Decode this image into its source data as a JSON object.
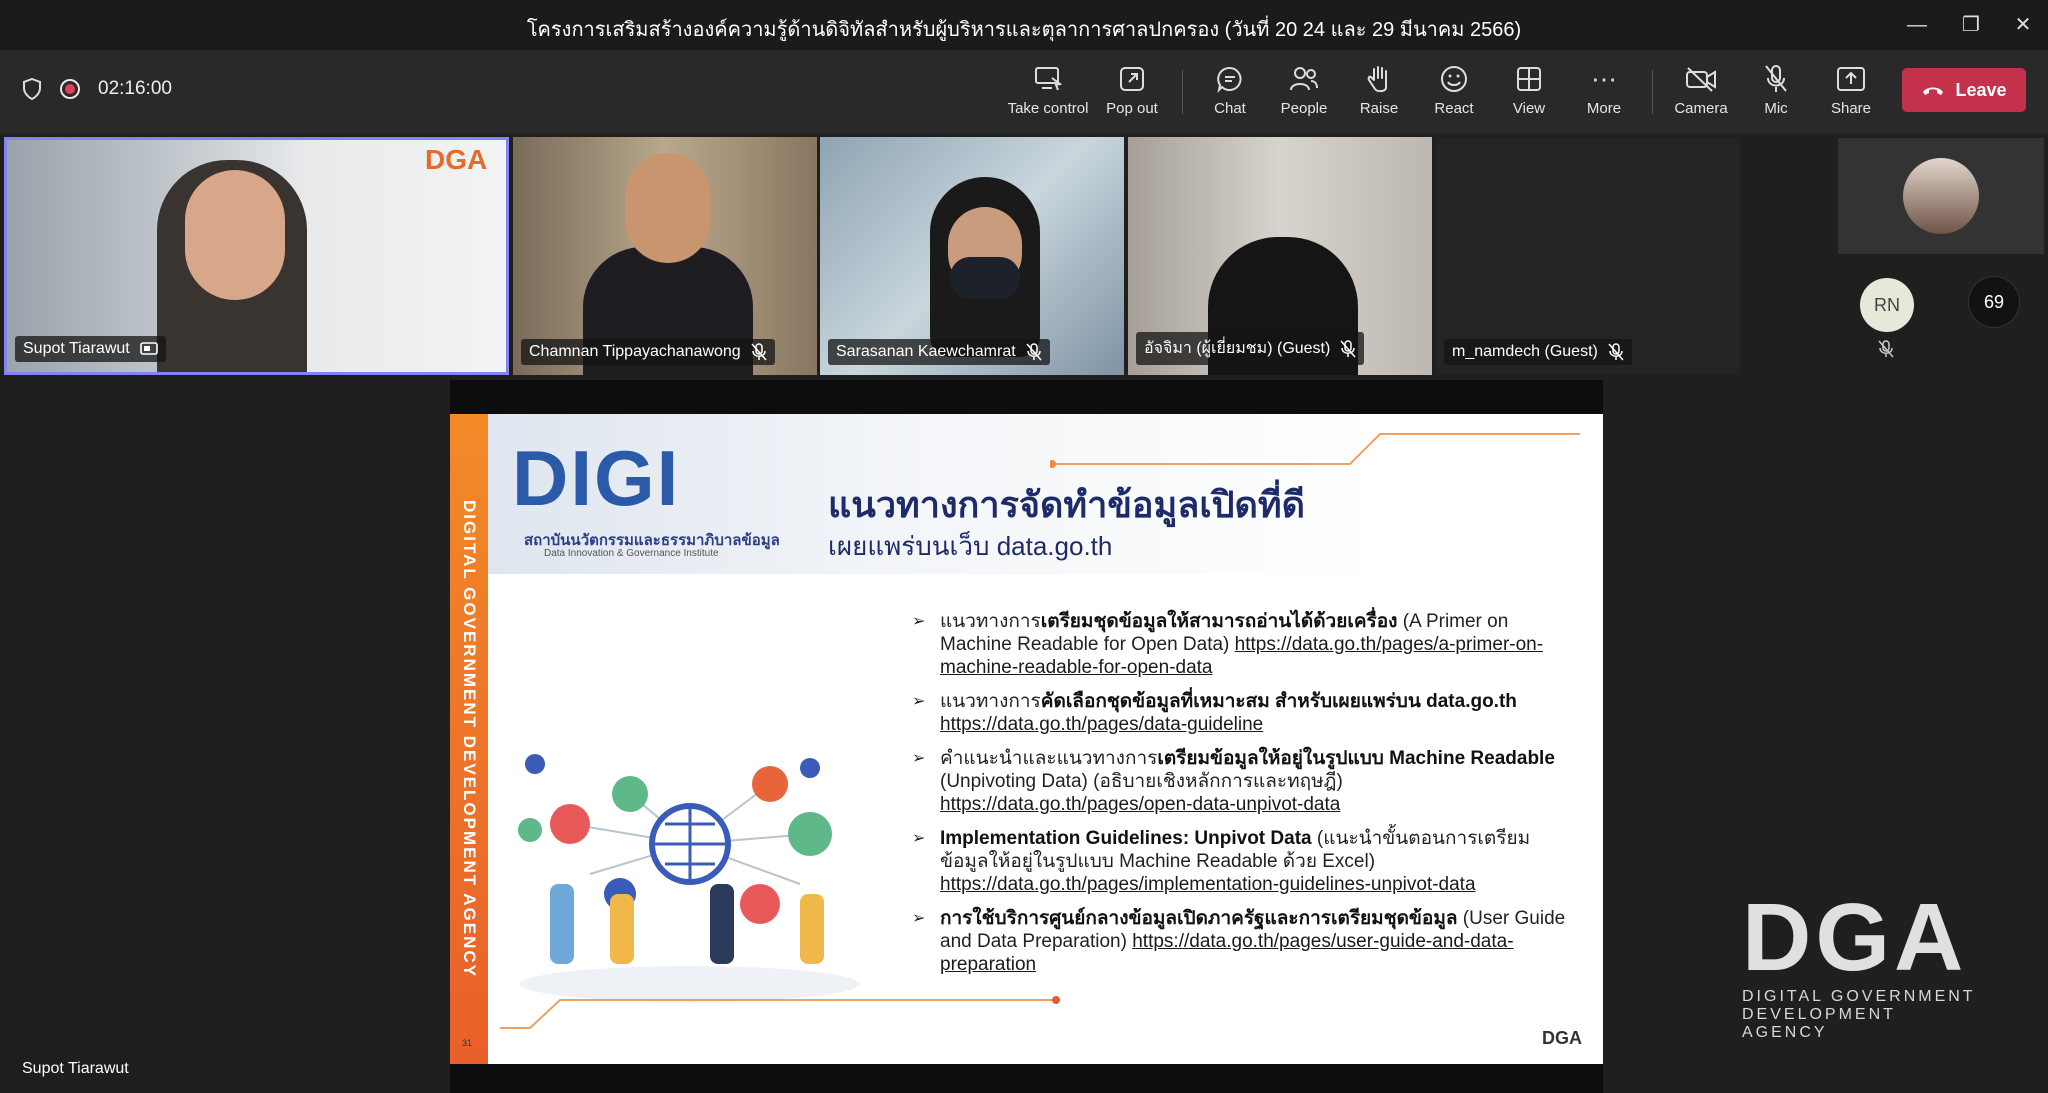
{
  "window": {
    "title": "โครงการเสริมสร้างองค์ความรู้ด้านดิจิทัลสำหรับผู้บริหารและตุลาการศาลปกครอง (วันที่ 20 24 และ 29 มีนาคม 2566)"
  },
  "toolbar": {
    "timer": "02:16:00",
    "take_control": "Take control",
    "pop_out": "Pop out",
    "chat": "Chat",
    "people": "People",
    "raise": "Raise",
    "react": "React",
    "view": "View",
    "more": "More",
    "camera": "Camera",
    "mic": "Mic",
    "share": "Share",
    "leave": "Leave"
  },
  "participants": [
    {
      "name": "Supot Tiarawut"
    },
    {
      "name": "Chamnan Tippayachanawong"
    },
    {
      "name": "Sarasanan Kaewchamrat"
    },
    {
      "name": "อัจจิมา (ผู้เยี่ยมชม) (Guest)"
    },
    {
      "name": "m_namdech (Guest)"
    }
  ],
  "overflow": {
    "avatar_initials": "RN",
    "count": "69"
  },
  "slide": {
    "vertical_text": "DIGITAL GOVERNMENT DEVELOPMENT AGENCY",
    "digi_logo": "DIGI",
    "digi_org_th": "สถาบันนวัตกรรมและธรรมาภิบาลข้อมูล",
    "digi_org_en": "Data Innovation & Governance Institute",
    "title": "แนวทางการจัดทำข้อมูลเปิดที่ดี",
    "subtitle": "เผยแพร่บนเว็บ data.go.th",
    "bullets": [
      {
        "pre": "แนวทางการ",
        "bold": "เตรียมชุดข้อมูลให้สามารถอ่านได้ด้วยเครื่อง",
        "post": " (A Primer on Machine Readable for Open Data) ",
        "link": "https://data.go.th/pages/a-primer-on-machine-readable-for-open-data"
      },
      {
        "pre": "แนวทางการ",
        "bold": "คัดเลือกชุดข้อมูลที่เหมาะสม สำหรับเผยแพร่บน data.go.th",
        "post": " ",
        "link": "https://data.go.th/pages/data-guideline"
      },
      {
        "pre": "คำแนะนำและแนวทางการ",
        "bold": "เตรียมข้อมูลให้อยู่ในรูปแบบ Machine Readable",
        "post": " (Unpivoting Data) (อธิบายเชิงหลักการและทฤษฎี) ",
        "link": "https://data.go.th/pages/open-data-unpivot-data"
      },
      {
        "pre": "",
        "bold": "Implementation Guidelines: Unpivot Data",
        "post": " (แนะนำขั้นตอนการเตรียมข้อมูลให้อยู่ในรูปแบบ Machine Readable ด้วย Excel) ",
        "link": "https://data.go.th/pages/implementation-guidelines-unpivot-data"
      },
      {
        "pre": "",
        "bold": "การใช้บริการศูนย์กลางข้อมูลเปิดภาครัฐและการเตรียมชุดข้อมูล",
        "post": " (User Guide and Data Preparation) ",
        "link": "https://data.go.th/pages/user-guide-and-data-preparation"
      }
    ],
    "page_number": "31",
    "small_logo": "DGA"
  },
  "speaker_label": "Supot Tiarawut",
  "dga_watermark": {
    "big": "DGA",
    "line1": "DIGITAL GOVERNMENT",
    "line2": "DEVELOPMENT AGENCY"
  }
}
